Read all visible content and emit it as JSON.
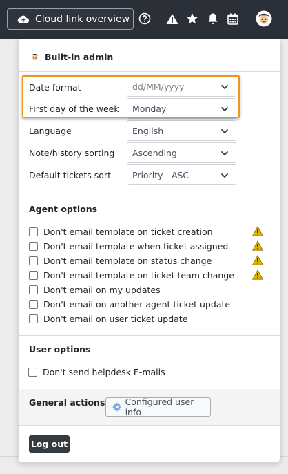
{
  "topbar": {
    "cloud_button_label": "Cloud link overview",
    "icons": [
      "cloud-icon",
      "help-icon",
      "warning-icon",
      "star-icon",
      "bell-icon",
      "calendar-icon",
      "user-avatar"
    ]
  },
  "panel": {
    "user_name": "Built-in admin",
    "preferences": [
      {
        "label": "Date format",
        "value": "dd/MM/yyyy"
      },
      {
        "label": "First day of the week",
        "value": "Monday"
      },
      {
        "label": "Language",
        "value": "English"
      },
      {
        "label": "Note/history sorting",
        "value": "Ascending"
      },
      {
        "label": "Default tickets sort",
        "value": "Priority - ASC"
      }
    ],
    "agent_options_title": "Agent options",
    "agent_options": [
      {
        "label": "Don't email template on ticket creation",
        "warning": true
      },
      {
        "label": "Don't email template when ticket assigned",
        "warning": true
      },
      {
        "label": "Don't email template on status change",
        "warning": true
      },
      {
        "label": "Don't email template on ticket team change",
        "warning": true
      },
      {
        "label": "Don't email on my updates",
        "warning": false
      },
      {
        "label": "Don't email on another agent ticket update",
        "warning": false
      },
      {
        "label": "Don't email on user ticket update",
        "warning": false
      }
    ],
    "user_options_title": "User options",
    "user_options": [
      {
        "label": "Don't send helpdesk E-mails"
      }
    ],
    "general_actions_title": "General actions",
    "configured_user_info_label": "Configured user info",
    "logout_label": "Log out"
  },
  "colors": {
    "topbar_bg": "#2b3038",
    "highlight": "#f0961e",
    "warning": "#e0b400",
    "logout_bg": "#343a40"
  }
}
